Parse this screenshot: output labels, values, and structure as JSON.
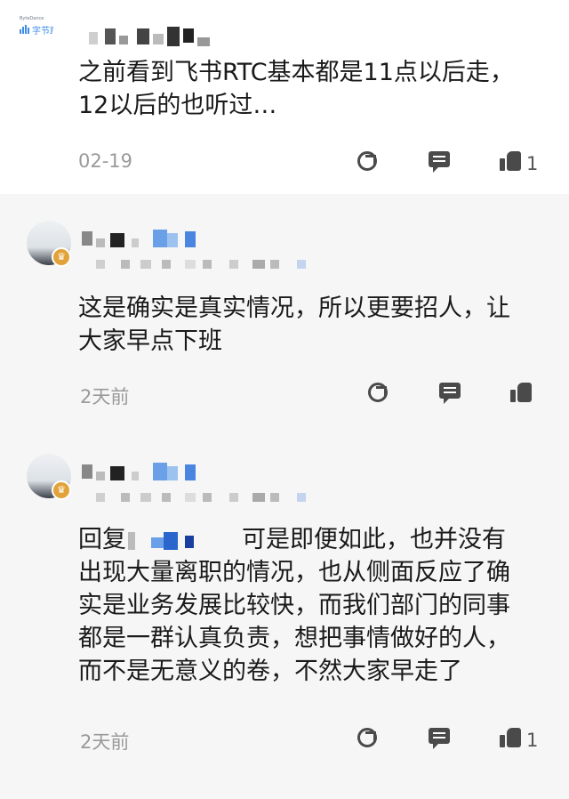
{
  "comments": [
    {
      "text": "之前看到飞书RTC基本都是11点以后走，\n12以后的也听过…",
      "time": "02-19",
      "logo": {
        "top": "ByteDance",
        "text": "字节跳动"
      },
      "actions": {
        "share_icon": "share-icon",
        "reply_icon": "message-icon",
        "like_icon": "thumbs-up-icon",
        "like_count": "1"
      }
    },
    {
      "text": "这是确实是真实情况，所以更要招人，让\n大家早点下班",
      "time": "2天前",
      "badge": "♛",
      "actions": {
        "share_icon": "share-icon",
        "reply_icon": "message-icon",
        "like_icon": "thumbs-up-icon",
        "like_count": ""
      }
    },
    {
      "text_prefix": "回复",
      "text_after": "可是即便如此，也并没有\n出现大量离职的情况，也从侧面反应了确\n实是业务发展比较快，而我们部门的同事\n都是一群认真负责，想把事情做好的人，\n而不是无意义的卷，不然大家早走了",
      "time": "2天前",
      "badge": "♛",
      "actions": {
        "share_icon": "share-icon",
        "reply_icon": "message-icon",
        "like_icon": "thumbs-up-icon",
        "like_count": "1"
      }
    }
  ],
  "colors": {
    "reply_bg": "#f6f6f6",
    "time_gray": "#9a9a9a",
    "badge_gold": "#e2a23a",
    "logo_blue": "#3c8ce7"
  }
}
